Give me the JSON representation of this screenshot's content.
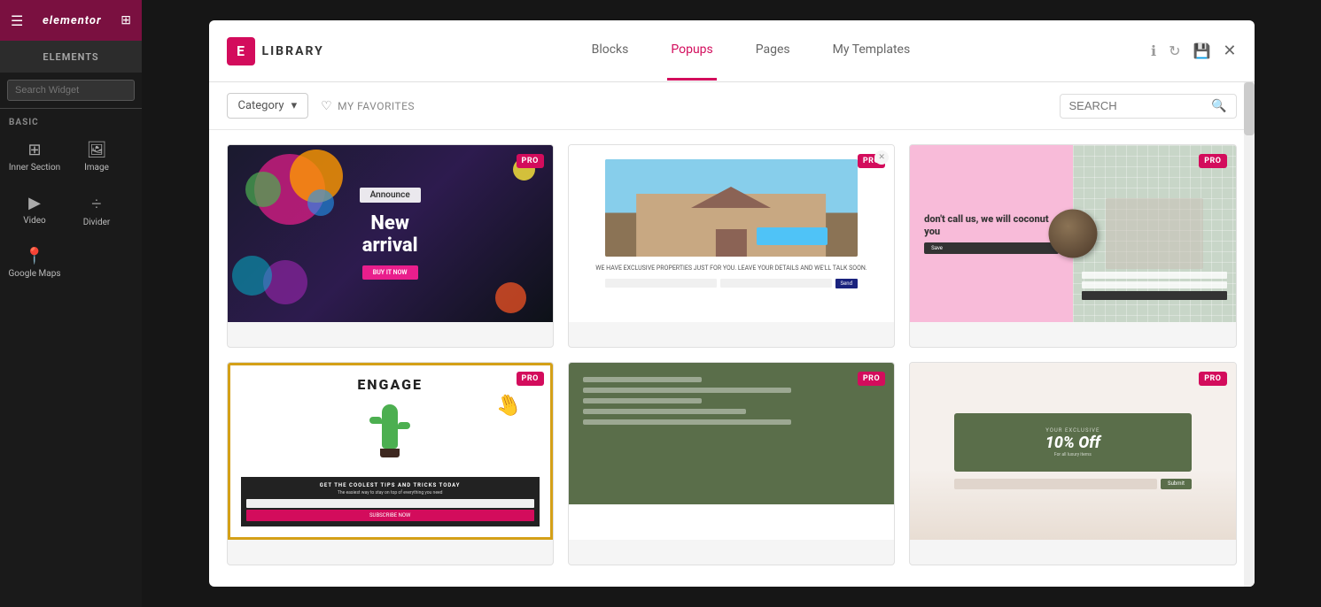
{
  "editor": {
    "logo_text": "elementor",
    "sidebar_tab": "ELEMENTS",
    "search_placeholder": "Search Widget",
    "basic_label": "BASIC",
    "items": [
      {
        "id": "inner-section",
        "icon": "⊞",
        "label": "Inner Section"
      },
      {
        "id": "image",
        "icon": "🖼",
        "label": "Image"
      },
      {
        "id": "video",
        "icon": "▶",
        "label": "Video"
      },
      {
        "id": "divider",
        "icon": "—",
        "label": "Divider"
      },
      {
        "id": "google-maps",
        "icon": "📍",
        "label": "Google Maps"
      }
    ]
  },
  "modal": {
    "logo_text": "LIBRARY",
    "tabs": [
      {
        "id": "blocks",
        "label": "Blocks",
        "active": false
      },
      {
        "id": "popups",
        "label": "Popups",
        "active": true
      },
      {
        "id": "pages",
        "label": "Pages",
        "active": false
      },
      {
        "id": "my-templates",
        "label": "My Templates",
        "active": false
      }
    ],
    "toolbar": {
      "category_label": "Category",
      "favorites_label": "MY FAVORITES",
      "search_placeholder": "SEARCH"
    },
    "templates": [
      {
        "id": "template-1",
        "badge": "PRO",
        "type": "announce-new-arrival",
        "announce_text": "Announce",
        "title_line1": "New",
        "title_line2": "arrival",
        "btn_text": "BUY IT NOW"
      },
      {
        "id": "template-2",
        "badge": "PRO",
        "type": "real-estate",
        "body_text": "WE HAVE EXCLUSIVE PROPERTIES JUST FOR YOU. LEAVE YOUR DETAILS AND WE'LL TALK SOON."
      },
      {
        "id": "template-3",
        "badge": "PRO",
        "type": "coconut",
        "title": "don't call us, we will coconut you",
        "btn_text": "Save"
      },
      {
        "id": "template-4",
        "badge": "PRO",
        "type": "engage",
        "title": "ENGAGE",
        "bottom_title": "GET THE COOLEST TIPS AND TRICKS TODAY",
        "btn_text": "SUBSCRIBE NOW"
      },
      {
        "id": "template-5",
        "badge": "PRO",
        "type": "green-menu"
      },
      {
        "id": "template-6",
        "badge": "PRO",
        "type": "discount",
        "small_text": "Your exclusive",
        "offer": "10% Off",
        "subtext": "For all luxury items",
        "btn_text": "Submit"
      }
    ]
  }
}
